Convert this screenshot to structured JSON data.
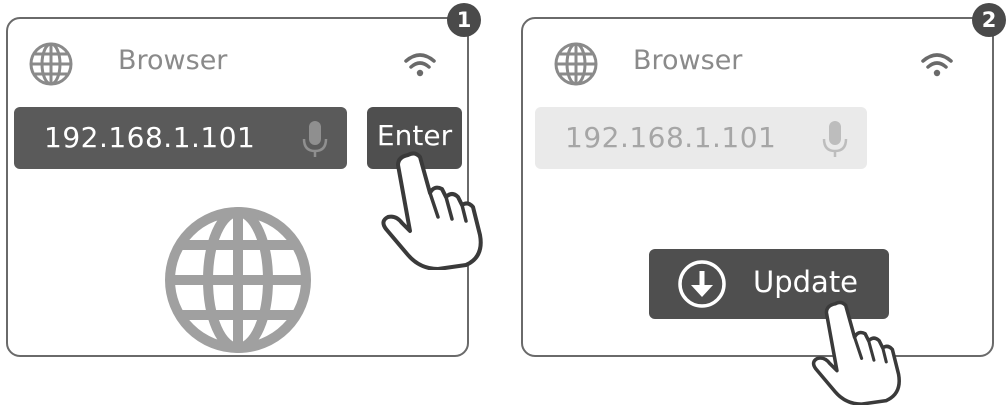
{
  "steps": [
    {
      "badge": "1",
      "app_title": "Browser",
      "address": "192.168.1.101",
      "action_label": "Enter",
      "address_state": "active"
    },
    {
      "badge": "2",
      "app_title": "Browser",
      "address": "192.168.1.101",
      "action_label": "Update",
      "address_state": "disabled"
    }
  ],
  "icons": {
    "globe": "globe-icon",
    "wifi": "wifi-icon",
    "mic": "microphone-icon",
    "download": "download-circle-icon",
    "hand": "pointing-hand-icon"
  },
  "colors": {
    "dark_fill": "#4f4f4f",
    "address_active": "#5a5a5a",
    "address_disabled": "#eaeaea",
    "icon_grey": "#8a8a8a",
    "border": "#6a6a6a"
  }
}
